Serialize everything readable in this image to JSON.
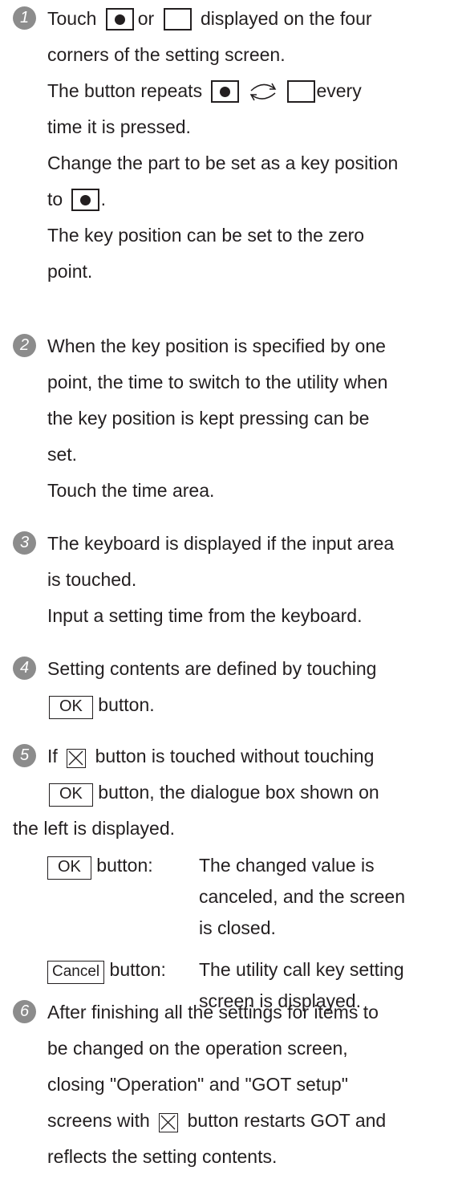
{
  "steps": [
    {
      "number": "1",
      "lines": {
        "l1_a": "Touch",
        "l1_b": "or",
        "l1_c": "displayed on the four",
        "l2": "corners of the setting screen.",
        "l3_a": "The button repeats",
        "l3_b": "every",
        "l4": "time it is pressed.",
        "l5": "Change the part to be set as a key position",
        "l6_a": "to",
        "l6_b": ".",
        "l7": "The key position can be set to the zero",
        "l8": "point."
      }
    },
    {
      "number": "2",
      "lines": [
        "When the key position is specified by one",
        "point, the time to switch to the utility when",
        "the key position is kept pressing can be",
        "set.",
        "Touch the time area."
      ]
    },
    {
      "number": "3",
      "lines": [
        "The keyboard is displayed if the input area",
        "is touched.",
        "Input a setting time from the keyboard."
      ]
    },
    {
      "number": "4",
      "lines": {
        "l1": "Setting contents are defined by touching",
        "l2_b": "button."
      }
    },
    {
      "number": "5",
      "lines": {
        "l1_a": "If",
        "l1_b": "button is touched without touching",
        "l2_b": "button, the dialogue box shown on",
        "l3": "the left is displayed."
      },
      "definitions": [
        {
          "term_suffix": "button:",
          "desc": [
            "The changed value is",
            "canceled, and the screen",
            "is closed."
          ]
        },
        {
          "term_suffix": "button:",
          "desc": [
            "The utility call key setting",
            "screen is displayed."
          ]
        }
      ]
    },
    {
      "number": "6",
      "lines": {
        "l1": "After finishing all the settings for items to",
        "l2": "be changed on the operation screen,",
        "l3": "closing \"Operation\" and \"GOT setup\"",
        "l4_a": "screens with",
        "l4_b": "button restarts GOT and",
        "l5": "reflects the setting contents."
      }
    }
  ],
  "buttons": {
    "ok": "OK",
    "cancel": "Cancel"
  },
  "icons": {
    "filled_square": "filled-dot-square-icon",
    "empty_square": "empty-square-icon",
    "cycle": "cycle-arrows-icon",
    "close": "close-x-icon"
  },
  "colors": {
    "number_badge": "#8c8c8c",
    "text": "#231f20"
  }
}
